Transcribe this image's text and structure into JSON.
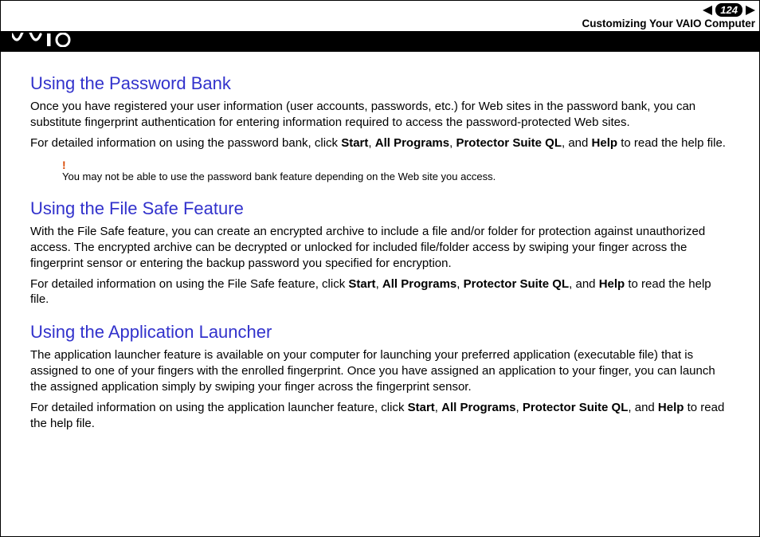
{
  "header": {
    "page_number": "124",
    "section_title": "Customizing Your VAIO Computer",
    "logo_text": "VAIO"
  },
  "sections": [
    {
      "heading": "Using the Password Bank",
      "p1": "Once you have registered your user information (user accounts, passwords, etc.) for Web sites in the password bank, you can substitute fingerprint authentication for entering information required to access the password-protected Web sites.",
      "p2_pre": "For detailed information on using the password bank, click ",
      "p2_b1": "Start",
      "p2_s1": ", ",
      "p2_b2": "All Programs",
      "p2_s2": ", ",
      "p2_b3": "Protector Suite QL",
      "p2_s3": ", and ",
      "p2_b4": "Help",
      "p2_post": " to read the help file.",
      "note_bang": "!",
      "note": "You may not be able to use the password bank feature depending on the Web site you access."
    },
    {
      "heading": "Using the File Safe Feature",
      "p1": "With the File Safe feature, you can create an encrypted archive to include a file and/or folder for protection against unauthorized access. The encrypted archive can be decrypted or unlocked for included file/folder access by swiping your finger across the fingerprint sensor or entering the backup password you specified for encryption.",
      "p2_pre": "For detailed information on using the File Safe feature, click ",
      "p2_b1": "Start",
      "p2_s1": ", ",
      "p2_b2": "All Programs",
      "p2_s2": ", ",
      "p2_b3": "Protector Suite QL",
      "p2_s3": ", and ",
      "p2_b4": "Help",
      "p2_post": " to read the help file."
    },
    {
      "heading": "Using the Application Launcher",
      "p1": "The application launcher feature is available on your computer for launching your preferred application (executable file) that is assigned to one of your fingers with the enrolled fingerprint. Once you have assigned an application to your finger, you can launch the assigned application simply by swiping your finger across the fingerprint sensor.",
      "p2_pre": "For detailed information on using the application launcher feature, click ",
      "p2_b1": "Start",
      "p2_s1": ", ",
      "p2_b2": "All Programs",
      "p2_s2": ", ",
      "p2_b3": "Protector Suite QL",
      "p2_s3": ", and ",
      "p2_b4": "Help",
      "p2_post": " to read the help file."
    }
  ]
}
